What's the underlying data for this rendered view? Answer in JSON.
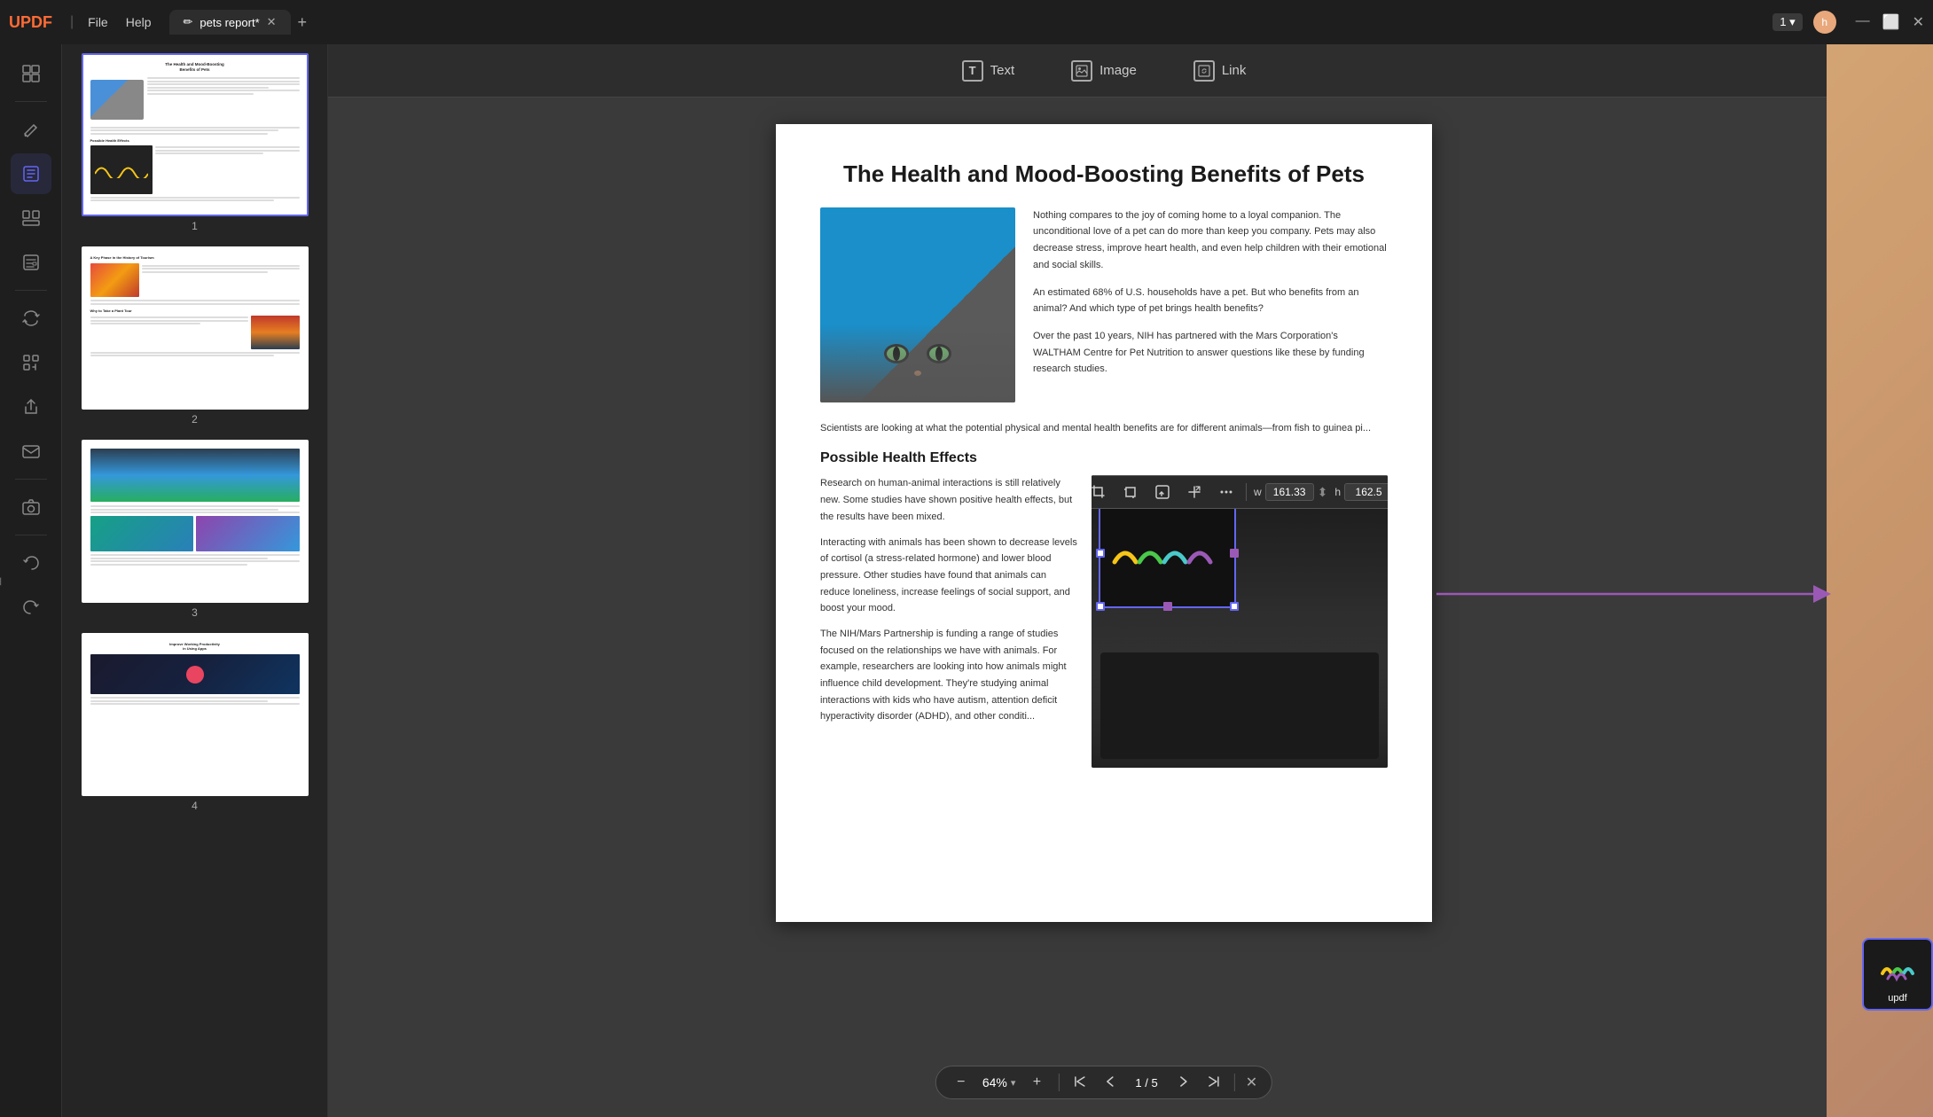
{
  "app": {
    "logo": "UPDF",
    "separator": "|",
    "menu": {
      "file": "File",
      "help": "Help"
    },
    "tab": {
      "icon": "✏",
      "name": "pets report*",
      "close": "✕"
    },
    "add_tab": "+",
    "page_num": "1",
    "page_num_dropdown": "▾",
    "user_icon": "h",
    "win_controls": {
      "minimize": "—",
      "maximize": "⬜",
      "close": "✕"
    }
  },
  "left_toolbar": {
    "tools": [
      {
        "name": "thumbnail-view",
        "icon": "⊞",
        "active": false
      },
      {
        "name": "divider1",
        "type": "divider"
      },
      {
        "name": "annotate",
        "icon": "✏",
        "active": false
      },
      {
        "name": "edit-pdf",
        "icon": "📝",
        "active": true
      },
      {
        "name": "organize",
        "icon": "⊟",
        "active": false
      },
      {
        "name": "forms",
        "icon": "☰",
        "active": false
      },
      {
        "name": "divider2",
        "type": "divider"
      },
      {
        "name": "convert",
        "icon": "↻",
        "active": false
      },
      {
        "name": "recognize",
        "icon": "◈",
        "active": false
      },
      {
        "name": "share",
        "icon": "⇧",
        "active": false
      },
      {
        "name": "email",
        "icon": "✉",
        "active": false
      },
      {
        "name": "divider3",
        "type": "divider"
      },
      {
        "name": "save-camera",
        "icon": "📷",
        "active": false
      },
      {
        "name": "divider4",
        "type": "divider"
      },
      {
        "name": "undo",
        "icon": "↩",
        "active": false
      },
      {
        "name": "redo",
        "icon": "↪",
        "active": false
      }
    ]
  },
  "edit_toolbar": {
    "items": [
      {
        "name": "text-tool",
        "icon": "T",
        "label": "Text",
        "icon_type": "box"
      },
      {
        "name": "image-tool",
        "icon": "🖼",
        "label": "Image",
        "icon_type": "image"
      },
      {
        "name": "link-tool",
        "icon": "🔗",
        "label": "Link",
        "icon_type": "link"
      }
    ]
  },
  "pdf": {
    "title": "The Health and Mood-Boosting Benefits of Pets",
    "intro_text_1": "Nothing compares to the joy of coming home to a loyal companion. The unconditional love of a pet can do more than keep you company. Pets may also decrease stress, improve heart health, and even help children with their emotional and social skills.",
    "intro_text_2": "An estimated 68% of U.S. households have a pet. But who benefits from an animal? And which type of pet brings health benefits?",
    "intro_text_3": "Over the past 10 years, NIH has partnered with the Mars Corporation's WALTHAM Centre for Pet Nutrition to answer questions like these by funding research studies.",
    "preview_text": "Scientists are looking at what the potential physical and mental health benefits are for different animals—from fish to guinea pi...",
    "section_title": "Possible Health Effects",
    "section_text_1": "Research on human-animal interactions is still relatively new. Some studies have shown positive health effects, but the results have been mixed.",
    "section_text_2": "Interacting with animals has been shown to decrease levels of cortisol (a stress-related hormone) and lower blood pressure. Other studies have found that animals can reduce loneliness, increase feelings of social support, and boost your mood.",
    "section_text_3": "The NIH/Mars Partnership is funding a range of studies focused on the relationships we have with animals. For example, researchers are looking into how animals might influence child development. They're studying animal interactions with kids who have autism, attention deficit hyperactivity disorder (ADHD), and other conditi..."
  },
  "image_toolbar": {
    "buttons": [
      "crop-alt",
      "crop",
      "replace",
      "resize",
      "more"
    ],
    "width_label": "w",
    "width_value": "161.33",
    "height_label": "h",
    "height_value": "162.5"
  },
  "zoom_bar": {
    "zoom_out": "−",
    "zoom_in": "+",
    "percent": "64%",
    "dropdown": "▾",
    "nav_first": "⏮",
    "nav_prev": "⬆",
    "nav_next": "⬇",
    "nav_last": "⏭",
    "page_current": "1",
    "page_total": "5",
    "close": "✕"
  },
  "right_toolbar": {
    "tools": [
      {
        "name": "search",
        "icon": "🔍"
      },
      {
        "name": "divider1",
        "type": "divider"
      },
      {
        "name": "ocr",
        "icon": "⊞"
      },
      {
        "name": "convert-r",
        "icon": "↗"
      },
      {
        "name": "protect",
        "icon": "🔒"
      },
      {
        "name": "share-r",
        "icon": "⇧"
      },
      {
        "name": "mail-r",
        "icon": "✉"
      },
      {
        "name": "divider2",
        "type": "divider"
      },
      {
        "name": "camera-r",
        "icon": "📷"
      },
      {
        "name": "divider3",
        "type": "divider"
      },
      {
        "name": "undo-r",
        "icon": "↩"
      },
      {
        "name": "redo-r",
        "icon": "↪"
      },
      {
        "name": "divider4",
        "type": "divider"
      },
      {
        "name": "app-icon",
        "icon": "✦"
      }
    ]
  },
  "thumbnails": [
    {
      "page": "1",
      "selected": true,
      "title": "The Health and Mood-Boosting Benefits of Pets"
    },
    {
      "page": "2",
      "selected": false,
      "title": "A Key Phase in the History of Tourism"
    },
    {
      "page": "3",
      "selected": false,
      "title": ""
    },
    {
      "page": "4",
      "selected": false,
      "title": "Improve Working Productivity in Using Apps"
    }
  ],
  "desktop_icon": {
    "label": "updf",
    "wavy_colors": [
      "#f5c518",
      "#4ac94a",
      "#4ac9c9",
      "#9b59b6"
    ]
  }
}
